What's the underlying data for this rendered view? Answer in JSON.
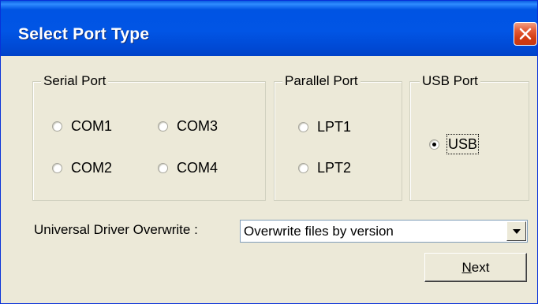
{
  "window": {
    "title": "Select Port Type",
    "close_icon": "close-icon"
  },
  "serial_group": {
    "label": "Serial Port",
    "options": [
      "COM1",
      "COM3",
      "COM2",
      "COM4"
    ]
  },
  "parallel_group": {
    "label": "Parallel Port",
    "options": [
      "LPT1",
      "LPT2"
    ]
  },
  "usb_group": {
    "label": "USB Port",
    "options": [
      "USB"
    ],
    "selected": "USB"
  },
  "driver_overwrite": {
    "label": "Universal Driver Overwrite :",
    "selected_value": "Overwrite files by version"
  },
  "buttons": {
    "next_mnemonic": "N",
    "next_rest": "ext"
  },
  "colors": {
    "titlebar": "#0054e3",
    "dialog_bg": "#ece9d8",
    "close_button": "#d23b12"
  }
}
